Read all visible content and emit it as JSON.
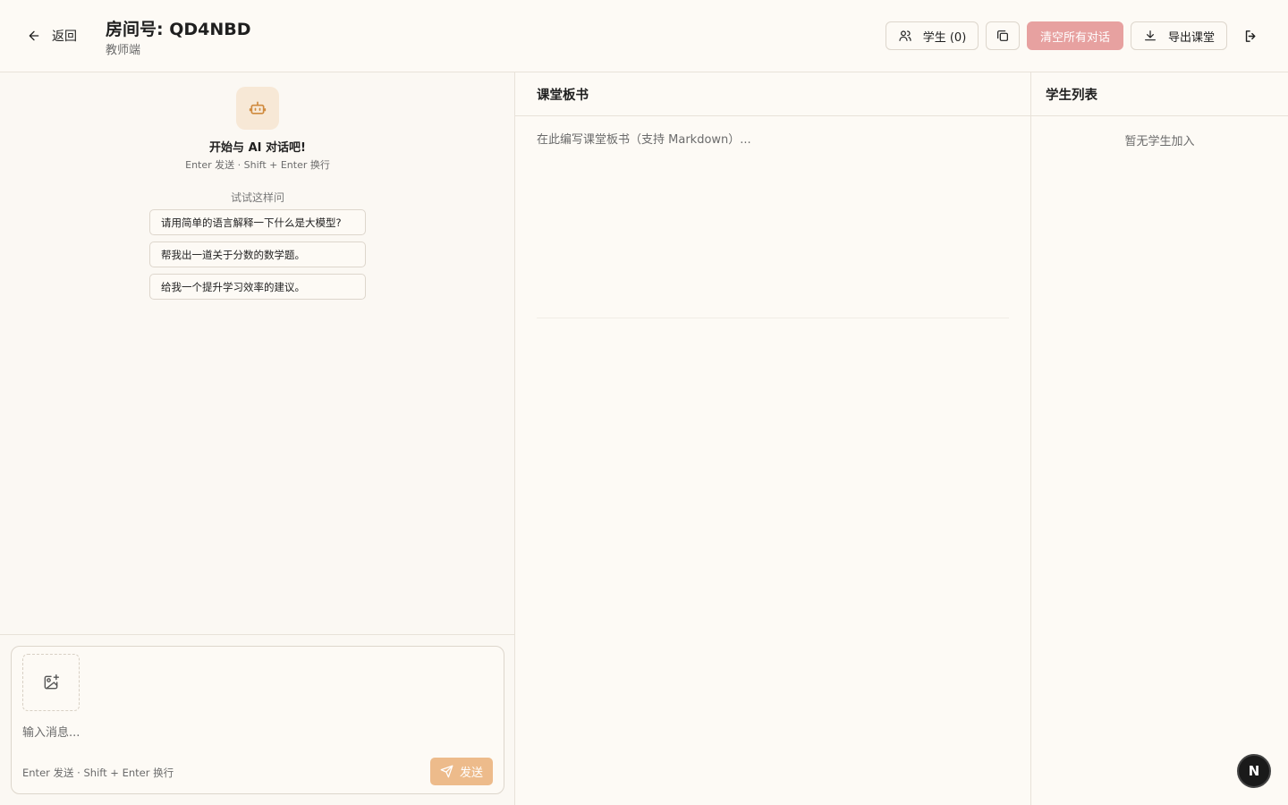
{
  "header": {
    "back_label": "返回",
    "room_title": "房间号: QD4NBD",
    "role_label": "教师端",
    "students_button": "学生 (0)",
    "clear_button": "清空所有对话",
    "export_button": "导出课堂"
  },
  "chat": {
    "welcome_title": "开始与 AI 对话吧!",
    "welcome_hint": "Enter 发送 · Shift + Enter 换行",
    "try_label": "试试这样问",
    "suggestions": [
      "请用简单的语言解释一下什么是大模型?",
      "帮我出一道关于分数的数学题。",
      "给我一个提升学习效率的建议。"
    ],
    "input_placeholder": "输入消息...",
    "input_hint": "Enter 发送 · Shift + Enter 换行",
    "send_label": "发送"
  },
  "board": {
    "title": "课堂板书",
    "placeholder": "在此编写课堂板书（支持 Markdown）..."
  },
  "students": {
    "title": "学生列表",
    "empty_text": "暂无学生加入"
  },
  "badge": {
    "letter": "N"
  },
  "colors": {
    "background": "#fdfaf5",
    "clear_button": "#e7a1a0",
    "send_button": "#edbb8b",
    "avatar_bg": "#f7e8d6",
    "avatar_icon": "#d08a3e"
  },
  "icons": {
    "back": "arrow-left-icon",
    "students": "users-icon",
    "copy": "copy-icon",
    "export": "download-icon",
    "logout": "logout-icon",
    "bot": "bot-icon",
    "upload": "image-plus-icon",
    "send": "send-icon"
  }
}
